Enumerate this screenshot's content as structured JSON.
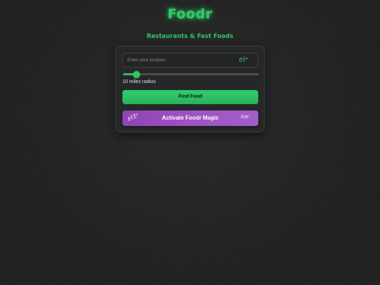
{
  "app": {
    "logo": "Foodr",
    "subtitle": "Restaurants & Fast Foods"
  },
  "search": {
    "placeholder": "Enter your location",
    "value": "",
    "location_icon_glyph": "ðŸ“"
  },
  "radius": {
    "value": 10,
    "fraction": 0.1,
    "label": "10 miles radius"
  },
  "buttons": {
    "find_label": "Find Food",
    "magic_label": "Activate Foodr Magic",
    "magic_icon_left": "ðŸŽ²",
    "magic_icon_right": "âœ¨"
  },
  "colors": {
    "accent": "#2fc566",
    "magic": "#9b4fc0",
    "background": "#1f1f1f"
  },
  "icons": {
    "location": "location-pin-icon",
    "magic_left": "dice-icon",
    "magic_right": "sparkles-icon"
  }
}
